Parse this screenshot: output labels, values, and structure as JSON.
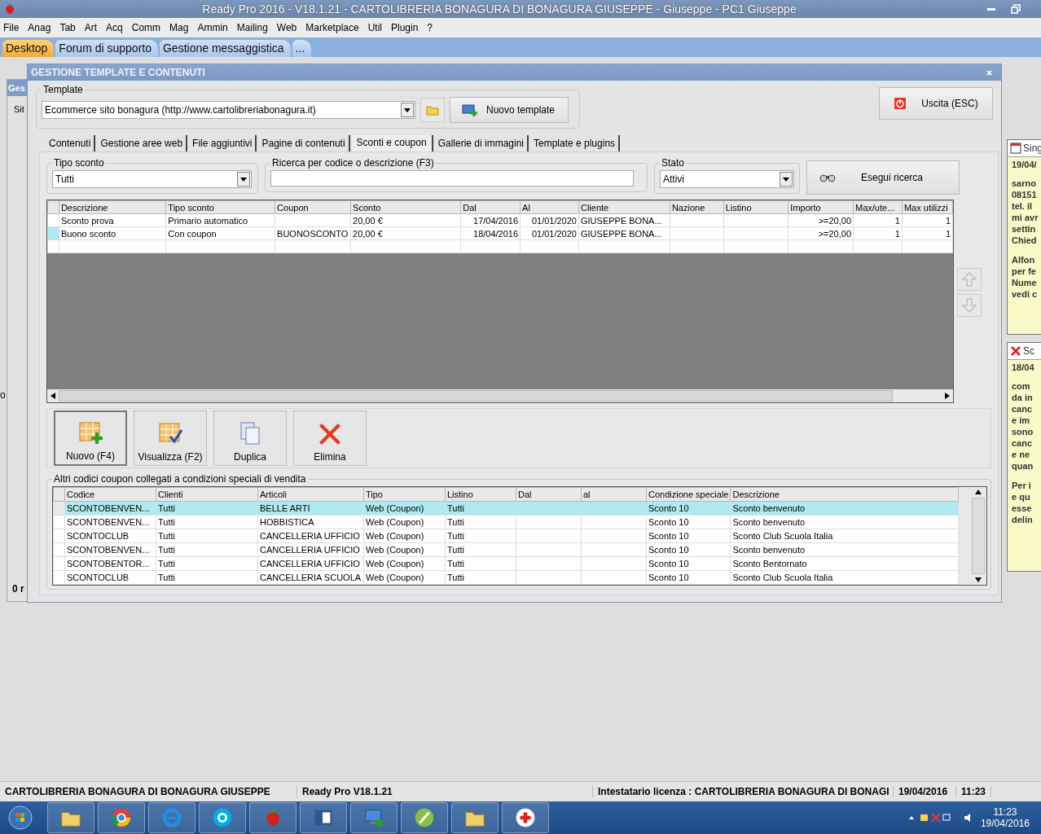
{
  "window": {
    "title": "Ready Pro 2016 - V18.1.21 - CARTOLIBRERIA BONAGURA DI BONAGURA GIUSEPPE - Giuseppe - PC1 Giuseppe"
  },
  "menu": [
    "File",
    "Anag",
    "Tab",
    "Art",
    "Acq",
    "Comm",
    "Mag",
    "Ammin",
    "Mailing",
    "Web",
    "Marketplace",
    "Util",
    "Plugin",
    "?"
  ],
  "desktop_tabs": [
    {
      "label": "Desktop",
      "selected": true
    },
    {
      "label": "Forum di supporto",
      "selected": false
    },
    {
      "label": "Gestione messaggistica",
      "selected": false
    },
    {
      "label": "...",
      "selected": false
    }
  ],
  "background_window": {
    "title": "Ges",
    "label": "Sit",
    "footer": "0 r",
    "side_text": "o"
  },
  "dialog": {
    "title": "GESTIONE TEMPLATE E CONTENUTI",
    "template": {
      "label": "Template",
      "value": "Ecommerce sito bonagura (http://www.cartolibreriabonagura.it)",
      "new_button": "Nuovo template"
    },
    "exit_button": "Uscita (ESC)",
    "tabs": [
      {
        "label": "Contenuti",
        "selected": false
      },
      {
        "label": "Gestione aree web",
        "selected": false
      },
      {
        "label": "File aggiuntivi",
        "selected": false
      },
      {
        "label": "Pagine di contenuti",
        "selected": false
      },
      {
        "label": "Sconti e coupon",
        "selected": true
      },
      {
        "label": "Gallerie di immagini",
        "selected": false
      },
      {
        "label": "Template e plugins",
        "selected": false
      }
    ],
    "filters": {
      "discount_type": {
        "label": "Tipo sconto",
        "value": "Tutti"
      },
      "search": {
        "label": "Ricerca per codice o descrizione (F3)"
      },
      "status": {
        "label": "Stato",
        "value": "Attivi"
      },
      "search_button": "Esegui ricerca"
    },
    "discounts_table": {
      "columns": [
        "Descrizione",
        "Tipo sconto",
        "Coupon",
        "Sconto",
        "Dal",
        "Al",
        "Cliente",
        "Nazione",
        "Listino",
        "Importo",
        "Max/ute...",
        "Max utilizzi"
      ],
      "rows": [
        {
          "selected": false,
          "cells": [
            "Sconto prova",
            "Primario automatico",
            "",
            "20,00 €",
            "17/04/2016",
            "01/01/2020",
            "GIUSEPPE BONA...",
            "",
            "",
            ">=20,00",
            "1",
            "1"
          ]
        },
        {
          "selected": true,
          "cells": [
            "Buono sconto",
            "Con coupon",
            "BUONOSCONTO",
            "20,00 €",
            "18/04/2016",
            "01/01/2020",
            "GIUSEPPE BONA...",
            "",
            "",
            ">=20,00",
            "1",
            "1"
          ]
        }
      ]
    },
    "actions": [
      {
        "label": "Nuovo (F4)",
        "kind": "new"
      },
      {
        "label": "Visualizza (F2)",
        "kind": "view"
      },
      {
        "label": "Duplica",
        "kind": "copy"
      },
      {
        "label": "Elimina",
        "kind": "delete"
      }
    ],
    "coupons": {
      "title": "Altri codici coupon collegati a condizioni speciali di vendita",
      "columns": [
        "Codice",
        "Clienti",
        "Articoli",
        "Tipo",
        "Listino",
        "Dal",
        "al",
        "Condizione speciale",
        "Descrizione"
      ],
      "rows": [
        {
          "selected": true,
          "cells": [
            "SCONTOBENVEN...",
            "Tutti",
            "BELLE ARTI",
            "Web (Coupon)",
            "Tutti",
            "",
            "",
            "Sconto 10",
            "Sconto benvenuto"
          ]
        },
        {
          "selected": false,
          "cells": [
            "SCONTOBENVEN...",
            "Tutti",
            "HOBBISTICA",
            "Web (Coupon)",
            "Tutti",
            "",
            "",
            "Sconto 10",
            "Sconto benvenuto"
          ]
        },
        {
          "selected": false,
          "cells": [
            "SCONTOCLUB",
            "Tutti",
            "CANCELLERIA UFFICIO",
            "Web (Coupon)",
            "Tutti",
            "",
            "",
            "Sconto 10",
            "Sconto Club Scuola Italia"
          ]
        },
        {
          "selected": false,
          "cells": [
            "SCONTOBENVEN...",
            "Tutti",
            "CANCELLERIA UFFICIO",
            "Web (Coupon)",
            "Tutti",
            "",
            "",
            "Sconto 10",
            "Sconto benvenuto"
          ]
        },
        {
          "selected": false,
          "cells": [
            "SCONTOBENTOR...",
            "Tutti",
            "CANCELLERIA UFFICIO",
            "Web (Coupon)",
            "Tutti",
            "",
            "",
            "Sconto 10",
            "Sconto Bentornato"
          ]
        },
        {
          "selected": false,
          "cells": [
            "SCONTOCLUB",
            "Tutti",
            "CANCELLERIA SCUOLA",
            "Web (Coupon)",
            "Tutti",
            "",
            "",
            "Sconto 10",
            "Sconto Club Scuola Italia"
          ]
        }
      ]
    }
  },
  "notes": [
    {
      "kind": "calendar",
      "title": "Sing",
      "date": "19/04/",
      "paragraphs": [
        [
          "sarno",
          "08151",
          "tel. il",
          "mi avr",
          "settin",
          "Chied"
        ],
        [
          "Alfon",
          "per fe",
          "Nume",
          "vedi c"
        ]
      ]
    },
    {
      "kind": "cancelled",
      "title": "Sc",
      "date": "18/04",
      "paragraphs": [
        [
          "com",
          "da in",
          "canc",
          "e im",
          "sono",
          "canc",
          "e ne",
          "quan"
        ],
        [
          "Per i",
          "e qu",
          "esse",
          "delin"
        ]
      ]
    }
  ],
  "status_bar": [
    "CARTOLIBRERIA BONAGURA DI BONAGURA GIUSEPPE",
    "Ready Pro V18.1.21",
    "Intestatario licenza : CARTOLIBRERIA BONAGURA DI BONAGI",
    "19/04/2016",
    "11:23"
  ],
  "taskbar": {
    "time": "11:23",
    "date": "19/04/2016"
  }
}
